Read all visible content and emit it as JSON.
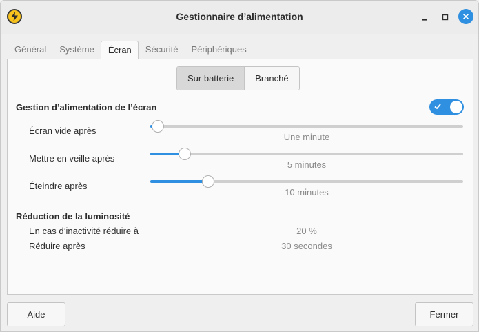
{
  "window": {
    "title": "Gestionnaire d’alimentation",
    "accent_color": "#2f8fe0",
    "app_icon": "power-bolt-icon"
  },
  "tabs": [
    {
      "label": "Général",
      "active": false
    },
    {
      "label": "Système",
      "active": false
    },
    {
      "label": "Écran",
      "active": true
    },
    {
      "label": "Sécurité",
      "active": false
    },
    {
      "label": "Périphériques",
      "active": false
    }
  ],
  "power_source": {
    "options": [
      "Sur batterie",
      "Branché"
    ],
    "selected": "Sur batterie"
  },
  "display_power": {
    "title": "Gestion d’alimentation de l’écran",
    "enabled": true,
    "rows": [
      {
        "label": "Écran vide après",
        "value_text": "Une minute",
        "level": 0.0
      },
      {
        "label": "Mettre en veille après",
        "value_text": "5 minutes",
        "level": 0.09
      },
      {
        "label": "Éteindre après",
        "value_text": "10 minutes",
        "level": 0.17
      }
    ]
  },
  "brightness": {
    "title": "Réduction de la luminosité",
    "rows": [
      {
        "label": "En cas d’inactivité réduire à",
        "value_text": "20 %"
      },
      {
        "label": "Réduire après",
        "value_text": "30 secondes"
      }
    ]
  },
  "footer": {
    "help_label": "Aide",
    "close_label": "Fermer"
  }
}
